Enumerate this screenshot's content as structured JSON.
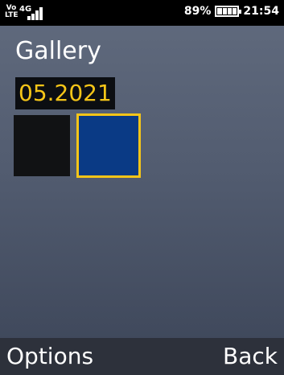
{
  "status_bar": {
    "volte_top": "Vo",
    "volte_bottom": "LTE",
    "network": "4G",
    "battery_percent": "89%",
    "battery_level": 0.89,
    "time": "21:54"
  },
  "header": {
    "title": "Gallery"
  },
  "album": {
    "date_label": "05.2021",
    "selected_index": 1,
    "accent_color": "#f5c518",
    "thumbnails": [
      {
        "color": "#111214"
      },
      {
        "color": "#0a3a85"
      }
    ]
  },
  "softkeys": {
    "left": "Options",
    "right": "Back"
  }
}
